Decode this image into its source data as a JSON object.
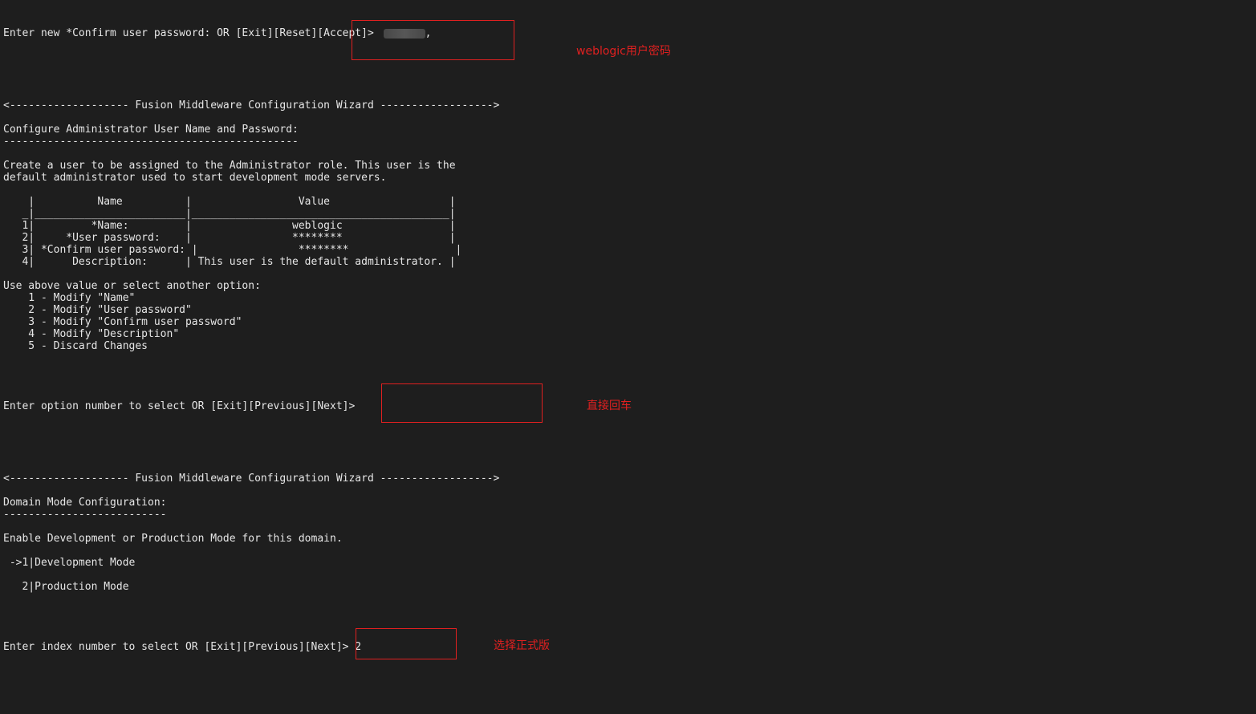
{
  "lines": {
    "confirm_prompt": "Enter new *Confirm user password: OR [Exit][Reset][Accept]> ",
    "masked_input_suffix": ",",
    "wizard_header_1": "<------------------- Fusion Middleware Configuration Wizard ------------------>",
    "admin_title": "Configure Administrator User Name and Password:",
    "admin_underline": "-----------------------------------------------",
    "desc_1": "Create a user to be assigned to the Administrator role. This user is the",
    "desc_2": "default administrator used to start development mode servers.",
    "table_header": "    |          Name          |                 Value                   |",
    "table_sep": "   _|________________________|_________________________________________|",
    "table_row_1": "   1|         *Name:         |                weblogic                 |",
    "table_row_2": "   2|     *User password:    |                ********                 |",
    "table_row_3": "   3| *Confirm user password: |                ********                 |",
    "table_row_4": "   4|      Description:      | This user is the default administrator. |",
    "use_above": "Use above value or select another option:",
    "opt_1": "    1 - Modify \"Name\"",
    "opt_2": "    2 - Modify \"User password\"",
    "opt_3": "    3 - Modify \"Confirm user password\"",
    "opt_4": "    4 - Modify \"Description\"",
    "opt_5": "    5 - Discard Changes",
    "option_prompt": "Enter option number to select OR [Exit][Previous][Next]>",
    "wizard_header_2": "<------------------- Fusion Middleware Configuration Wizard ------------------>",
    "domain_title": "Domain Mode Configuration:",
    "domain_underline": "--------------------------",
    "domain_desc": "Enable Development or Production Mode for this domain.",
    "mode_1": " ->1|Development Mode",
    "mode_2": "   2|Production Mode",
    "index_prompt": "Enter index number to select OR [Exit][Previous][Next]> 2"
  },
  "annotations": {
    "password": "weblogic用户密码",
    "enter": "直接回车",
    "production": "选择正式版"
  },
  "colors": {
    "background": "#1e1e1e",
    "text": "#e6e6e6",
    "annotation": "#e02020"
  }
}
